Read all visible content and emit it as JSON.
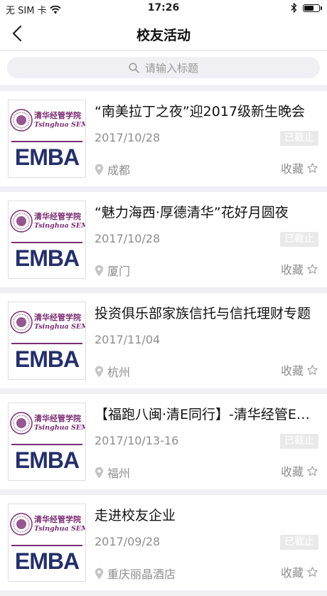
{
  "status_bar": {
    "carrier": "无 SIM 卡",
    "time": "17:26",
    "battery_level": 0.7
  },
  "nav": {
    "title": "校友活动"
  },
  "search": {
    "placeholder": "请输入标题"
  },
  "logo": {
    "school_cn": "清华经管学院",
    "school_en": "Tsinghua SEM",
    "program": "EMBA"
  },
  "events": [
    {
      "title": "“南美拉丁之夜”迎2017级新生晚会",
      "date": "2017/10/28",
      "status": "已截止",
      "location": "成都",
      "fav_label": "收藏"
    },
    {
      "title": "“魅力海西·厚德清华”花好月圆夜",
      "date": "2017/10/28",
      "status": "已截止",
      "location": "厦门",
      "fav_label": "收藏"
    },
    {
      "title": "投资俱乐部家族信托与信托理财专题",
      "date": "2017/11/04",
      "status": "",
      "location": "杭州",
      "fav_label": "收藏"
    },
    {
      "title": "【福跑八闽·清E同行】-清华经管EMBA",
      "date": "2017/10/13-16",
      "status": "已截止",
      "location": "福州",
      "fav_label": "收藏"
    },
    {
      "title": "走进校友企业",
      "date": "2017/09/28",
      "status": "已截止",
      "location": "重庆丽晶酒店",
      "fav_label": "收藏"
    }
  ],
  "colors": {
    "logo_purple": "#7a2d73",
    "logo_navy": "#242f6a",
    "background": "#efeff4"
  }
}
